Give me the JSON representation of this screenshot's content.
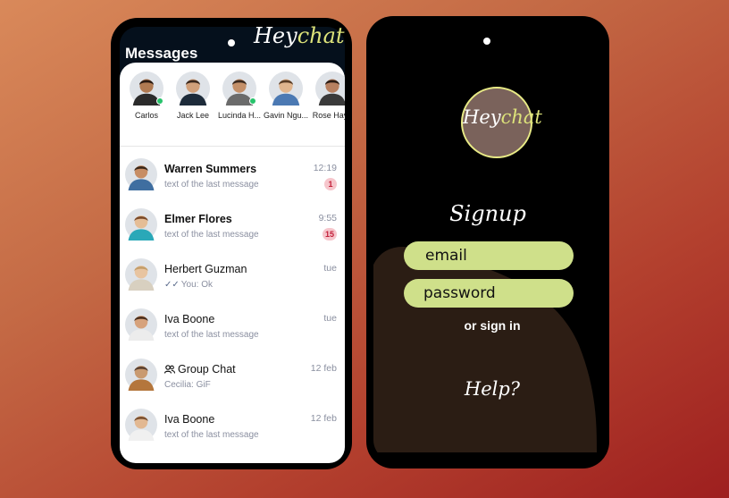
{
  "brand": {
    "hey": "Hey",
    "chat": "chat"
  },
  "left": {
    "title": "Messages",
    "stories": [
      {
        "name": "Carlos",
        "online": true,
        "skin": "#b07a52",
        "hair": "#2a1a12",
        "shirt": "#2b2b2b"
      },
      {
        "name": "Jack Lee",
        "online": false,
        "skin": "#d1a07a",
        "hair": "#3a281d",
        "shirt": "#1d2b3a"
      },
      {
        "name": "Lucinda H...",
        "online": true,
        "skin": "#c49069",
        "hair": "#3b2a1f",
        "shirt": "#6b6b6b"
      },
      {
        "name": "Gavin Ngu...",
        "online": false,
        "skin": "#e0b58e",
        "hair": "#5a3d26",
        "shirt": "#4b79b3"
      },
      {
        "name": "Rose Hayn",
        "online": false,
        "skin": "#b78060",
        "hair": "#2b1c14",
        "shirt": "#3a3a3a"
      }
    ],
    "chats": [
      {
        "name": "Warren Summers",
        "bold": true,
        "preview": "text of the last message",
        "time": "12:19",
        "unread": "1",
        "skin": "#c78d64",
        "hair": "#3a2719",
        "shirt": "#3f6ea0"
      },
      {
        "name": "Elmer Flores",
        "bold": true,
        "preview": "text of the last message",
        "time": "9:55",
        "unread": "15",
        "skin": "#e5bd96",
        "hair": "#7a4a2a",
        "shirt": "#2aa8b8"
      },
      {
        "name": "Herbert Guzman",
        "bold": false,
        "preview": "You: Ok",
        "ticks": "✓✓",
        "time": "tue",
        "skin": "#e8c4a0",
        "hair": "#c49e6a",
        "shirt": "#d8d0c0"
      },
      {
        "name": "Iva Boone",
        "bold": false,
        "preview": "text of the last message",
        "time": "tue",
        "skin": "#d6a27c",
        "hair": "#4a2e1c",
        "shirt": "#ececec"
      },
      {
        "name": "Group Chat",
        "bold": false,
        "group": true,
        "preview": "Cecilia: GiF",
        "time": "12 feb",
        "skin": "#c99a70",
        "hair": "#5a4030",
        "shirt": "#b4763c"
      },
      {
        "name": "Iva Boone",
        "bold": false,
        "preview": "text of the last message",
        "time": "12 feb",
        "skin": "#e2b892",
        "hair": "#7a5030",
        "shirt": "#f0f0f0"
      }
    ]
  },
  "right": {
    "signup_title": "Signup",
    "email_placeholder": "email",
    "password_placeholder": "password",
    "alt_link": "or sign in",
    "help": "Help?"
  },
  "colors": {
    "accent": "#cfe08a",
    "brown": "#2b1d14",
    "unread_bg": "#f6c6cc",
    "unread_fg": "#c2203a"
  }
}
